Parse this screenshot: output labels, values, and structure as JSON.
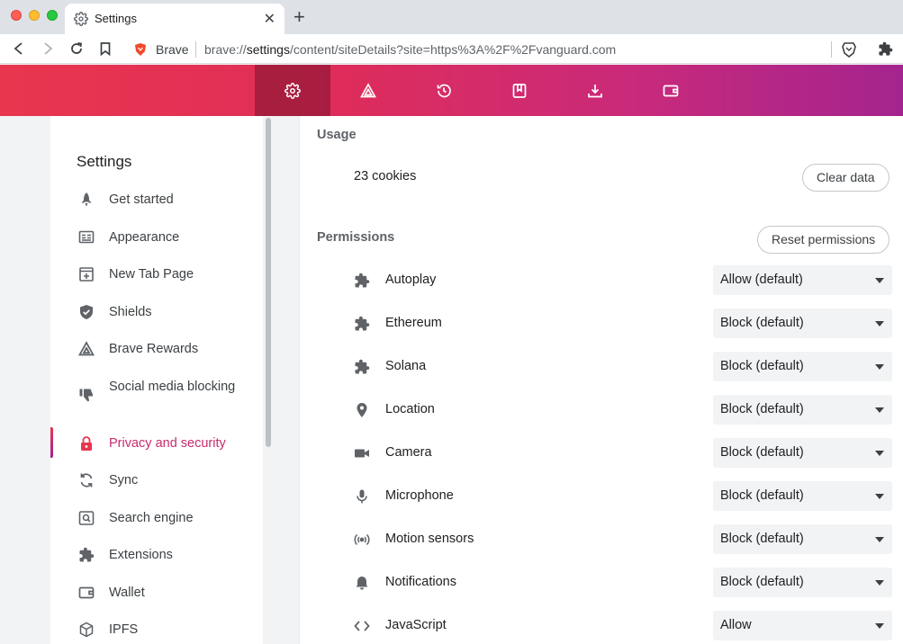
{
  "window": {
    "tab_title": "Settings",
    "tab_close_glyph": "✕",
    "new_tab_glyph": "+"
  },
  "omnibox": {
    "brand": "Brave",
    "url_prefix": "brave://",
    "url_host": "settings",
    "url_path": "/content/siteDetails?site=https%3A%2F%2Fvanguard.com"
  },
  "header": {
    "icons": [
      "gear-icon",
      "rewards-triangle-icon",
      "history-icon",
      "bookmarks-icon",
      "downloads-icon",
      "wallet-icon"
    ]
  },
  "sidebar": {
    "title": "Settings",
    "items": [
      {
        "label": "Get started",
        "icon": "rocket-icon"
      },
      {
        "label": "Appearance",
        "icon": "appearance-icon"
      },
      {
        "label": "New Tab Page",
        "icon": "new-tab-page-icon"
      },
      {
        "label": "Shields",
        "icon": "shield-icon"
      },
      {
        "label": "Brave Rewards",
        "icon": "rewards-triangle-icon"
      },
      {
        "label": "Social media blocking",
        "icon": "thumbs-down-icon"
      },
      {
        "label": "Privacy and security",
        "icon": "lock-icon",
        "active": true
      },
      {
        "label": "Sync",
        "icon": "sync-icon"
      },
      {
        "label": "Search engine",
        "icon": "search-engine-icon"
      },
      {
        "label": "Extensions",
        "icon": "puzzle-icon"
      },
      {
        "label": "Wallet",
        "icon": "wallet-icon"
      },
      {
        "label": "IPFS",
        "icon": "ipfs-cube-icon"
      }
    ]
  },
  "main": {
    "usage_heading": "Usage",
    "cookies_text": "23 cookies",
    "clear_data_label": "Clear data",
    "permissions_heading": "Permissions",
    "reset_permissions_label": "Reset permissions",
    "permissions": [
      {
        "label": "Autoplay",
        "value": "Allow (default)",
        "icon": "puzzle-icon"
      },
      {
        "label": "Ethereum",
        "value": "Block (default)",
        "icon": "puzzle-icon"
      },
      {
        "label": "Solana",
        "value": "Block (default)",
        "icon": "puzzle-icon"
      },
      {
        "label": "Location",
        "value": "Block (default)",
        "icon": "location-pin-icon"
      },
      {
        "label": "Camera",
        "value": "Block (default)",
        "icon": "camera-icon"
      },
      {
        "label": "Microphone",
        "value": "Block (default)",
        "icon": "microphone-icon"
      },
      {
        "label": "Motion sensors",
        "value": "Block (default)",
        "icon": "motion-sensors-icon"
      },
      {
        "label": "Notifications",
        "value": "Block (default)",
        "icon": "bell-icon"
      },
      {
        "label": "JavaScript",
        "value": "Allow",
        "icon": "code-brackets-icon"
      }
    ]
  },
  "colors": {
    "accent": "#c92a6f",
    "header_start": "#e8364f",
    "header_end": "#a4248f"
  }
}
